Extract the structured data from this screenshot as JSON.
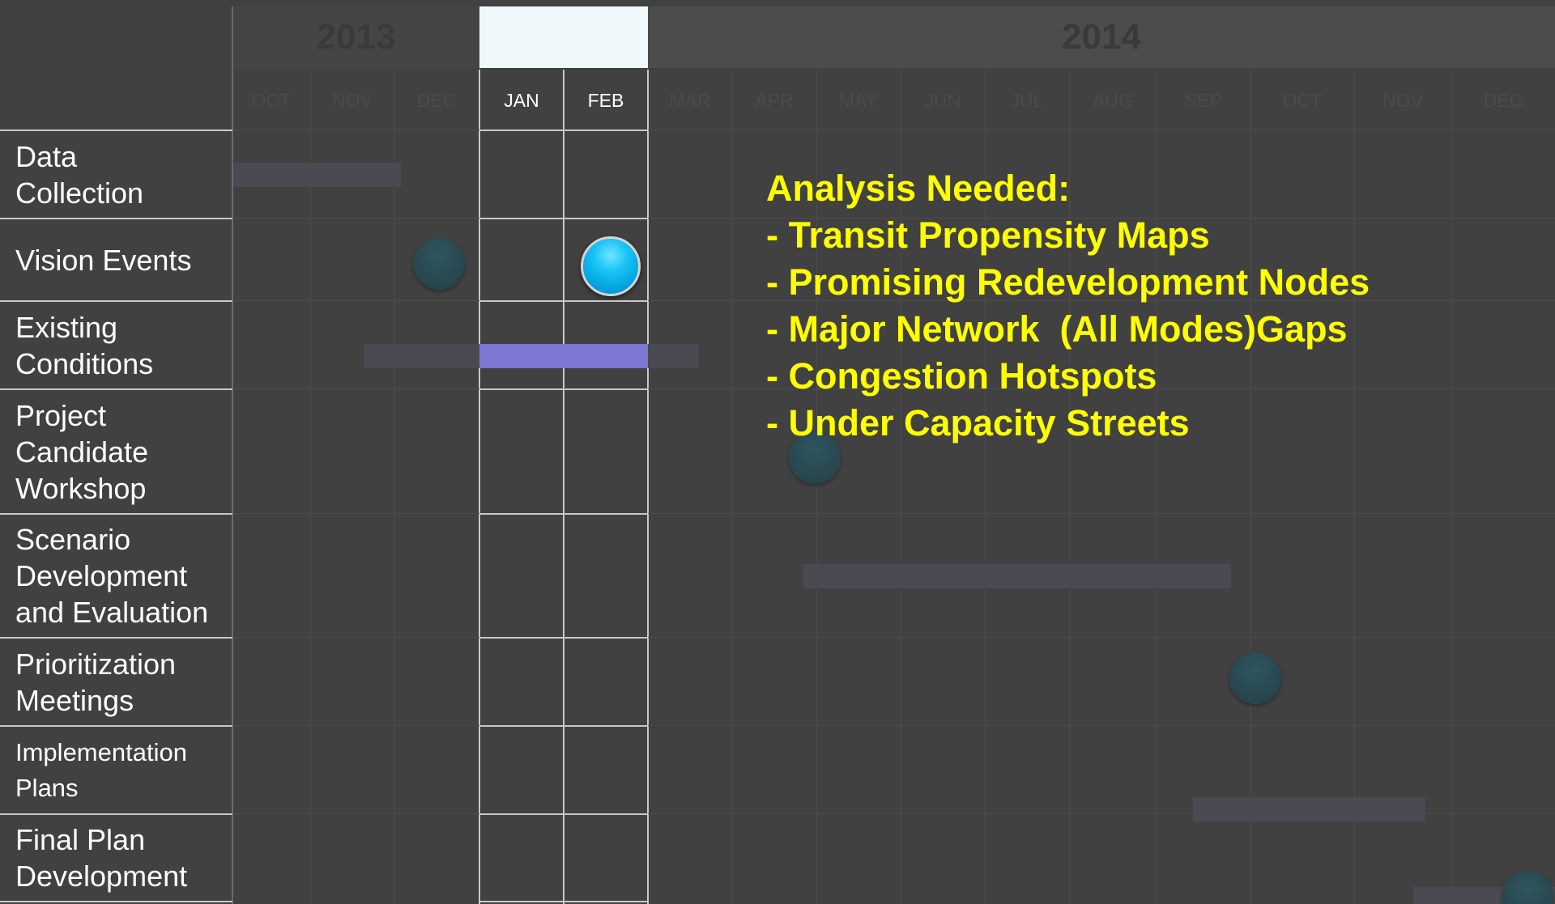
{
  "years": {
    "left": "2013",
    "right": "2014"
  },
  "months": [
    "OCT",
    "NOV",
    "DEC",
    "JAN",
    "FEB",
    "MAR",
    "APR",
    "MAY",
    "JUN",
    "JUL",
    "AUG",
    "SEP",
    "OCT",
    "NOV",
    "DEC"
  ],
  "tasks": [
    "Data\nCollection",
    "Vision Events",
    "Existing\nConditions",
    "Project\nCandidate\nWorkshop",
    "Scenario\nDevelopment\nand Evaluation",
    "Prioritization\nMeetings",
    "Implementation\nPlans",
    "Final Plan\nDevelopment"
  ],
  "annotation": {
    "heading": "Analysis Needed:",
    "items": [
      "- Transit Propensity Maps",
      "- Promising Redevelopment Nodes",
      "- Major Network  (All Modes)Gaps",
      "- Congestion Hotspots",
      "- Under Capacity Streets"
    ]
  },
  "colors": {
    "background": "#414141",
    "highlight_band": "#f1f8fb",
    "active_bar": "#7b77d3",
    "active_milestone": "#19c3f5",
    "annotation_text": "#ffff00"
  }
}
